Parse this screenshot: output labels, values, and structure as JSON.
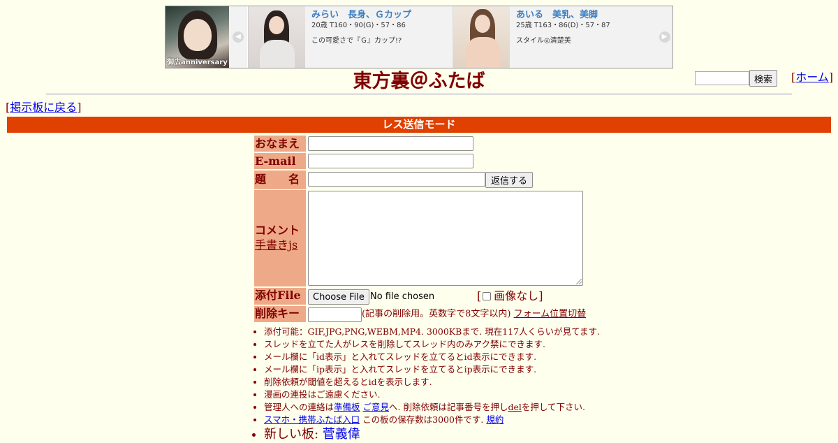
{
  "ad": {
    "main_caption": "御広anniversary",
    "prev_arrow": "◀",
    "next_arrow": "▶",
    "cards": [
      {
        "name": "みらい　長身、Ｇカップ",
        "spec": "20歳 T160・90(G)・57・86",
        "desc": "この可愛さで『Ｇ』カップ!?"
      },
      {
        "name": "あいる　美乳、美脚",
        "spec": "25歳 T163・86(D)・57・87",
        "desc": "スタイル◎清楚美"
      }
    ]
  },
  "header": {
    "title": "東方裏＠ふたば",
    "search_button": "検索",
    "home_link": "ホーム",
    "back_link": "掲示板に戻る",
    "bracket_open": "[",
    "bracket_close": "]"
  },
  "mode_bar": {
    "label": "レス送信モード"
  },
  "form": {
    "name_label": "おなまえ",
    "email_label": "E-mail",
    "subject_label": "題　　名",
    "reply_button": "返信する",
    "comment_label": "コメント",
    "handwriting_link": "手書きjs",
    "file_label": "添付File",
    "choose_file_button": "Choose File",
    "no_file_text": "No file chosen",
    "no_image_label": "画像なし",
    "delete_key_label": "削除キー",
    "delete_key_note": "(記事の削除用。英数字で8文字以内)",
    "form_position_link": "フォーム位置切替"
  },
  "rules": {
    "r1": "添付可能：GIF,JPG,PNG,WEBM,MP4. 3000KBまで. 現在117人くらいが見てます.",
    "r2": "スレッドを立てた人がレスを削除してスレッド内のみアク禁にできます.",
    "r3": "メール欄に「id表示」と入れてスレッドを立てるとid表示にできます.",
    "r4": "メール欄に「ip表示」と入れてスレッドを立てるとip表示にできます.",
    "r5": "削除依頼が閾値を超えるとidを表示します.",
    "r6": "漫画の連投はご遠慮ください.",
    "r7_prefix": "管理人への連絡は",
    "r7_link1": "準備板",
    "r7_link2": "ご意見",
    "r7_mid": "へ. 削除依頼は記事番号を押し",
    "r7_link3": "del",
    "r7_suffix": "を押して下さい.",
    "r8_link": "スマホ・携帯ふたば入口",
    "r8_text": " この板の保存数は3000件です.",
    "r8_rules_link": "規約",
    "r9_prefix": "新しい板: ",
    "r9_link": "菅義偉"
  }
}
